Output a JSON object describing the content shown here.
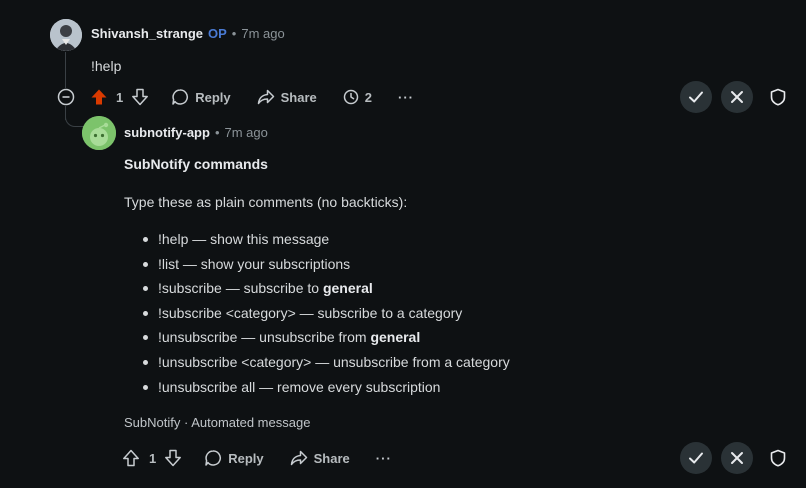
{
  "comment1": {
    "username": "Shivansh_strange",
    "op_badge": "OP",
    "separator": "•",
    "time": "7m ago",
    "body": "!help",
    "actions": {
      "votes": "1",
      "reply": "Reply",
      "share": "Share",
      "award_count": "2",
      "more": "···"
    }
  },
  "comment2": {
    "username": "subnotify-app",
    "separator": "•",
    "time": "7m ago",
    "title": "SubNotify commands",
    "intro": "Type these as plain comments (no backticks):",
    "commands": [
      {
        "text": "!help — show this message"
      },
      {
        "text": "!list — show your subscriptions"
      },
      {
        "pre": "!subscribe — subscribe to ",
        "bold": "general"
      },
      {
        "text": "!subscribe <category> — subscribe to a category"
      },
      {
        "pre": "!unsubscribe — unsubscribe from ",
        "bold": "general"
      },
      {
        "text": "!unsubscribe <category> — unsubscribe from a category"
      },
      {
        "text": "!unsubscribe all — remove every subscription"
      }
    ],
    "footer": "SubNotify · Automated message",
    "actions": {
      "votes": "1",
      "reply": "Reply",
      "share": "Share",
      "more": "···"
    }
  },
  "colors": {
    "background": "#0e1113",
    "upvote_active": "#d93a00",
    "op_badge": "#4a7bd4",
    "bot_avatar": "#7cc36b"
  }
}
